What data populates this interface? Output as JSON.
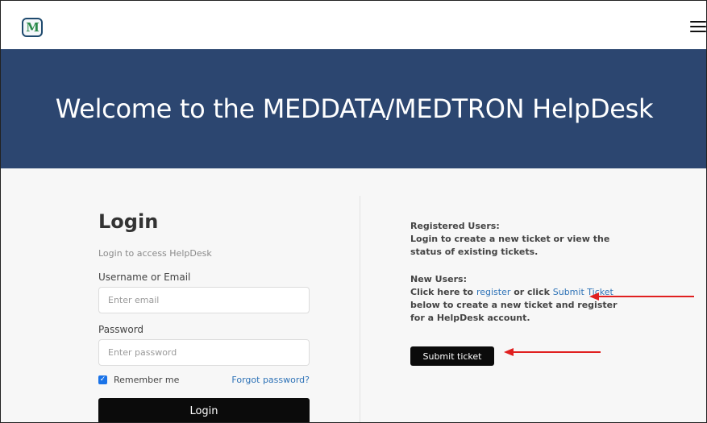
{
  "header": {
    "logo_glyph": "M",
    "menu_icon": "hamburger-menu-icon"
  },
  "hero": {
    "title": "Welcome to the MEDDATA/MEDTRON HelpDesk"
  },
  "login": {
    "title": "Login",
    "subtitle": "Login to access HelpDesk",
    "username_label": "Username or Email",
    "username_placeholder": "Enter email",
    "password_label": "Password",
    "password_placeholder": "Enter password",
    "remember_label": "Remember me",
    "remember_checked": true,
    "forgot_label": "Forgot password?",
    "button_label": "Login"
  },
  "info": {
    "registered_heading": "Registered Users:",
    "registered_text": "Login to create a new ticket or view the status of existing tickets.",
    "new_heading": "New Users:",
    "new_text_1": "Click here to ",
    "register_link": "register",
    "new_text_2": " or click ",
    "submit_link": "Submit Ticket",
    "new_text_3": " below to create a new ticket and register for a HelpDesk account.",
    "submit_button": "Submit ticket"
  },
  "annotations": {
    "arrow_color": "#e02020"
  },
  "colors": {
    "hero_bg": "#2c4670",
    "link": "#2f73b7",
    "button_bg": "#0b0b0b"
  }
}
